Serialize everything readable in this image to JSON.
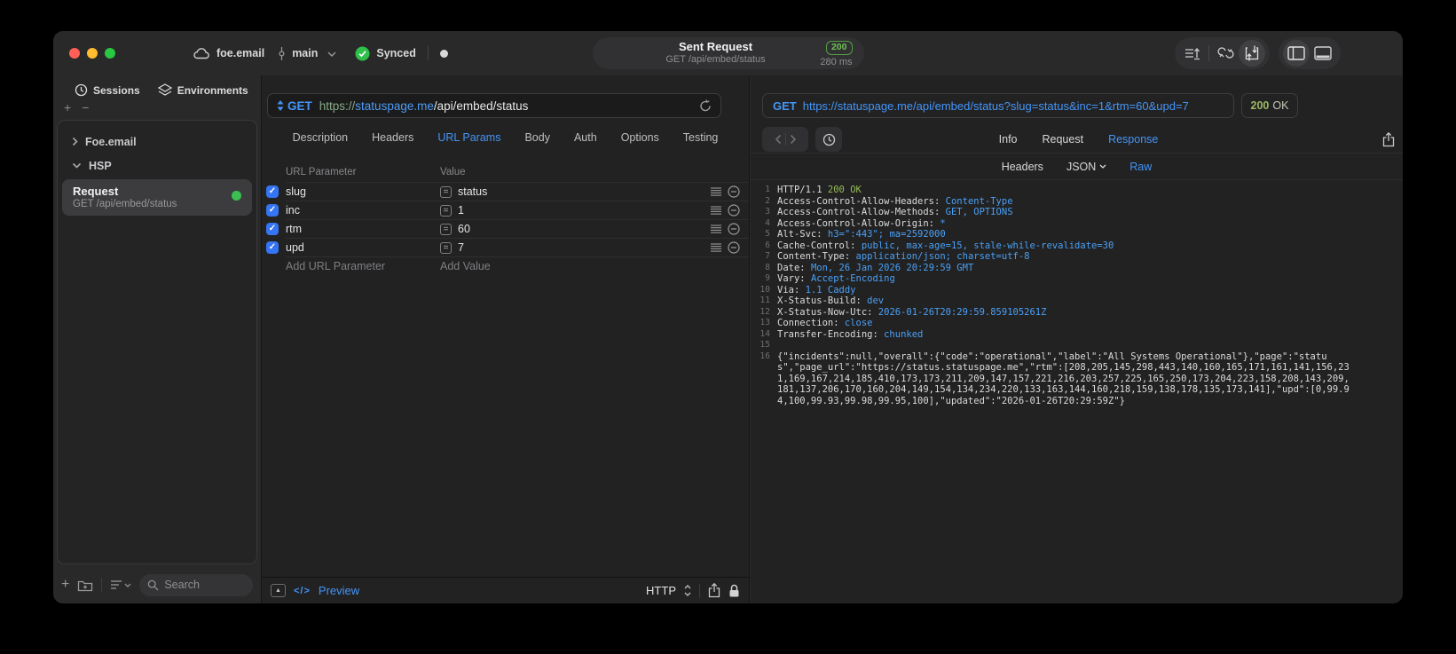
{
  "colors": {
    "accent_blue": "#4495f7",
    "code_blue": "#4aa0f5",
    "status_green": "#6fc254",
    "response_green": "#93bc55",
    "checkbox_blue": "#3574f2",
    "sync_green": "#2fbf4a",
    "record_green": "#3bbf51",
    "traffic_red": "#ff5f57",
    "traffic_yellow": "#febc2e",
    "traffic_green": "#28c840",
    "panel_bg": "#222223",
    "window_bg": "#29292a"
  },
  "icons": {
    "cloud-icon": "cloud outline",
    "branch-icon": "git commit line+node",
    "chevron-down-icon": "v",
    "sync-check-icon": "green circle + check",
    "unsaved-dot-icon": "filled dot",
    "import-list-icon": "lines + up arrow",
    "compare-icon": "two curved arrows",
    "send-receive-icon": "box + up/down arrows",
    "sidebar-toggle-icon": "window left pane",
    "bottom-panel-toggle-icon": "window bottom pane",
    "sessions-icon": "clock",
    "environments-icon": "stacked layers",
    "plus-icon": "+",
    "minus-icon": "−",
    "folder-add-icon": "folder with plus",
    "list-sort-icon": "lines + v",
    "search-icon": "magnifier",
    "method-stepper-icon": "up/down triangles",
    "refresh-icon": "circular arrow",
    "check-icon": "✓",
    "equals-icon": "=",
    "reorder-icon": "hamburger lines",
    "remove-icon": "circle minus",
    "collapse-icon": "▲",
    "code-icon": "</>",
    "updown-icon": "up/down chevrons",
    "share-icon": "square + up arrow",
    "lock-icon": "padlock",
    "back-icon": "‹",
    "forward-icon": "›",
    "history-icon": "clock"
  },
  "titlebar": {
    "project": "foe.email",
    "branch": "main",
    "sync_status": "Synced",
    "request_title": "Sent Request",
    "request_subtitle": "GET /api/embed/status",
    "status_code": "200",
    "duration": "280 ms"
  },
  "sidebar": {
    "tabs": [
      {
        "label": "Sessions"
      },
      {
        "label": "Environments"
      }
    ],
    "tree": [
      {
        "label": "Foe.email",
        "state": "collapsed"
      },
      {
        "label": "HSP",
        "state": "expanded"
      }
    ],
    "request_item": {
      "title": "Request",
      "subtitle": "GET /api/embed/status"
    },
    "search_placeholder": "Search"
  },
  "request_panel": {
    "method": "GET",
    "url_scheme": "https://",
    "url_host": "statuspage.me",
    "url_path": "/api/embed/status",
    "tabs": [
      "Description",
      "Headers",
      "URL Params",
      "Body",
      "Auth",
      "Options",
      "Testing"
    ],
    "active_tab": "URL Params",
    "param_table": {
      "columns": [
        "URL Parameter",
        "Value"
      ],
      "rows": [
        {
          "name": "slug",
          "value": "status",
          "enabled": true
        },
        {
          "name": "inc",
          "value": "1",
          "enabled": true
        },
        {
          "name": "rtm",
          "value": "60",
          "enabled": true
        },
        {
          "name": "upd",
          "value": "7",
          "enabled": true
        }
      ],
      "add_name_placeholder": "Add URL Parameter",
      "add_value_placeholder": "Add Value"
    },
    "footer": {
      "preview_label": "Preview",
      "code_glyph": "</>",
      "http_label": "HTTP"
    }
  },
  "response_panel": {
    "method": "GET",
    "url": "https://statuspage.me/api/embed/status?slug=status&inc=1&rtm=60&upd=7",
    "status_code": "200",
    "status_text": "OK",
    "tabs": [
      "Info",
      "Request",
      "Response"
    ],
    "active_tab": "Response",
    "subtabs": [
      "Headers",
      "JSON",
      "Raw"
    ],
    "active_subtab": "Raw",
    "lines": [
      {
        "n": "1",
        "parts": [
          {
            "t": "HTTP/1.1 ",
            "c": "p"
          },
          {
            "t": "200 OK",
            "c": "g"
          }
        ]
      },
      {
        "n": "2",
        "parts": [
          {
            "t": "Access-Control-Allow-Headers: ",
            "c": "p"
          },
          {
            "t": "Content-Type",
            "c": "b"
          }
        ]
      },
      {
        "n": "3",
        "parts": [
          {
            "t": "Access-Control-Allow-Methods: ",
            "c": "p"
          },
          {
            "t": "GET, OPTIONS",
            "c": "b"
          }
        ]
      },
      {
        "n": "4",
        "parts": [
          {
            "t": "Access-Control-Allow-Origin: ",
            "c": "p"
          },
          {
            "t": "*",
            "c": "b"
          }
        ]
      },
      {
        "n": "5",
        "parts": [
          {
            "t": "Alt-Svc: ",
            "c": "p"
          },
          {
            "t": "h3=\":443\"; ma=2592000",
            "c": "b"
          }
        ]
      },
      {
        "n": "6",
        "parts": [
          {
            "t": "Cache-Control: ",
            "c": "p"
          },
          {
            "t": "public, max-age=15, stale-while-revalidate=30",
            "c": "b"
          }
        ]
      },
      {
        "n": "7",
        "parts": [
          {
            "t": "Content-Type: ",
            "c": "p"
          },
          {
            "t": "application/json; charset=utf-8",
            "c": "b"
          }
        ]
      },
      {
        "n": "8",
        "parts": [
          {
            "t": "Date: ",
            "c": "p"
          },
          {
            "t": "Mon, 26 Jan 2026 20:29:59 GMT",
            "c": "b"
          }
        ]
      },
      {
        "n": "9",
        "parts": [
          {
            "t": "Vary: ",
            "c": "p"
          },
          {
            "t": "Accept-Encoding",
            "c": "b"
          }
        ]
      },
      {
        "n": "10",
        "parts": [
          {
            "t": "Via: ",
            "c": "p"
          },
          {
            "t": "1.1 Caddy",
            "c": "b"
          }
        ]
      },
      {
        "n": "11",
        "parts": [
          {
            "t": "X-Status-Build: ",
            "c": "p"
          },
          {
            "t": "dev",
            "c": "b"
          }
        ]
      },
      {
        "n": "12",
        "parts": [
          {
            "t": "X-Status-Now-Utc: ",
            "c": "p"
          },
          {
            "t": "2026-01-26T20:29:59.859105261Z",
            "c": "b"
          }
        ]
      },
      {
        "n": "13",
        "parts": [
          {
            "t": "Connection: ",
            "c": "p"
          },
          {
            "t": "close",
            "c": "b"
          }
        ]
      },
      {
        "n": "14",
        "parts": [
          {
            "t": "Transfer-Encoding: ",
            "c": "p"
          },
          {
            "t": "chunked",
            "c": "b"
          }
        ]
      },
      {
        "n": "15",
        "parts": []
      },
      {
        "n": "16",
        "parts": [
          {
            "t": "{\"incidents\":null,\"overall\":{\"code\":\"operational\",\"label\":\"All Systems Operational\"},\"page\":\"status\",\"page_url\":\"https://status.statuspage.me\",\"rtm\":[208,205,145,298,443,140,160,165,171,161,141,156,231,169,167,214,185,410,173,173,211,209,147,157,221,216,203,257,225,165,250,173,204,223,158,208,143,209,181,137,206,170,160,204,149,154,134,234,220,133,163,144,160,218,159,138,178,135,173,141],\"upd\":[0,99.94,100,99.93,99.98,99.95,100],\"updated\":\"2026-01-26T20:29:59Z\"}",
            "c": "p"
          }
        ]
      }
    ]
  }
}
